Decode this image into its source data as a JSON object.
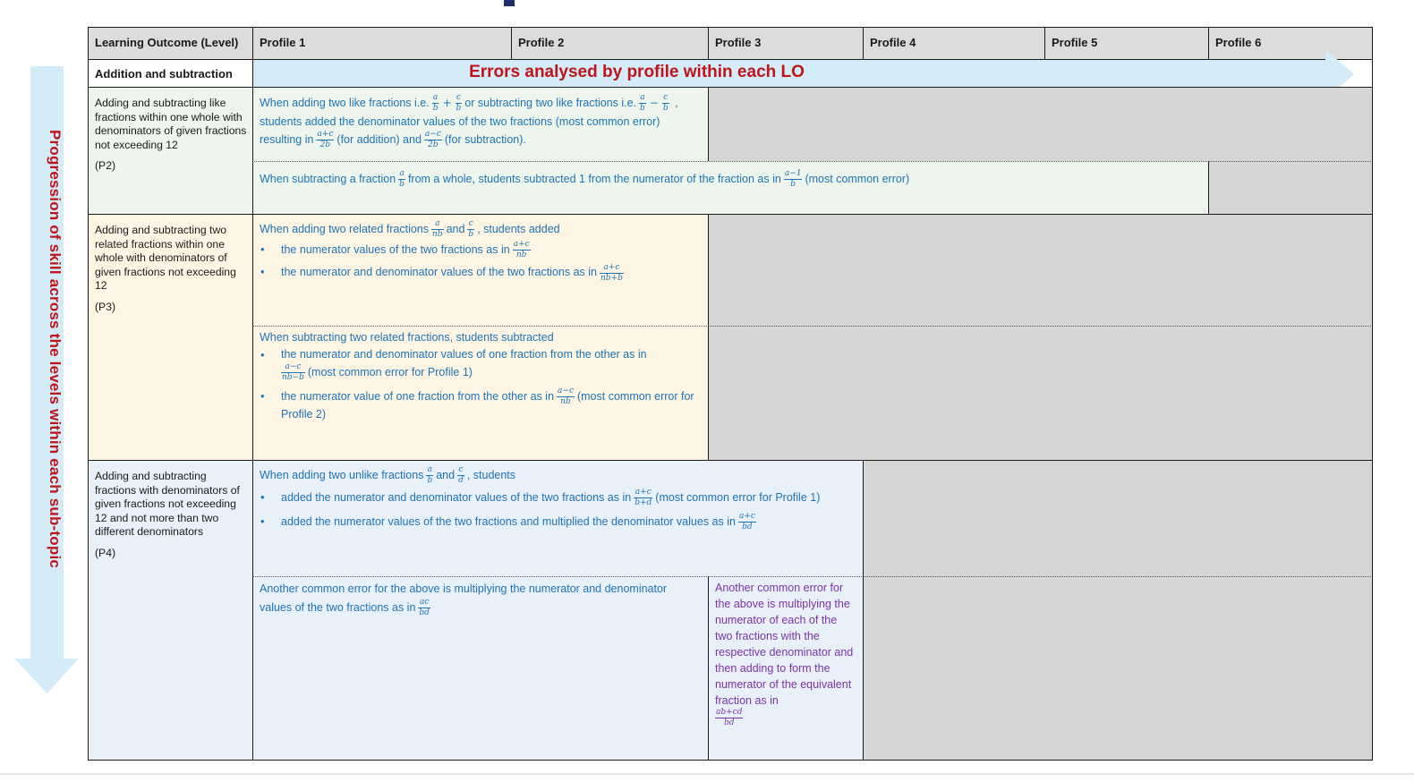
{
  "colors": {
    "header_bg": "#dcdcdc",
    "grey_cell": "#d6d6d6",
    "p2_bg": "#eef5ec",
    "p3_bg": "#fdf5e4",
    "p4_bg": "#e8f0f9",
    "arrow": "#d3ecf7",
    "red_text": "#c0141a",
    "blue_text": "#1f73b7",
    "purple_text": "#7c33a8"
  },
  "side_label": "Progression of skill across the levels within each sub-topic",
  "header": {
    "lo_col": "Learning Outcome (Level)",
    "profiles": [
      "Profile 1",
      "Profile 2",
      "Profile 3",
      "Profile 4",
      "Profile 5",
      "Profile 6"
    ]
  },
  "subtopic": {
    "name": "Addition and subtraction",
    "arrow_text": "Errors analysed by profile within each LO"
  },
  "rows": {
    "p2": {
      "lo_text": "Adding and subtracting like fractions within one whole with denominators of given fractions not exceeding 12",
      "level": "(P2)",
      "e1": {
        "t1": "When adding two like fractions i.e.",
        "t2": "or subtracting two like fractions i.e.",
        "t3": ", students added the denominator values of the two fractions (most common error) resulting in",
        "t4": "(for addition) and",
        "t5": "(for subtraction)."
      },
      "e2": {
        "t1": "When subtracting a fraction",
        "t2": "from a whole, students subtracted 1 from the numerator of the fraction as in",
        "t3": "(most common error)"
      }
    },
    "p3": {
      "lo_text": "Adding and subtracting two related fractions within one whole with denominators of given fractions not exceeding 12",
      "level": "(P3)",
      "e1": {
        "t1": "When adding two related fractions",
        "t2": "and",
        "t3": ", students added",
        "b1": "the numerator values of the two fractions as in",
        "b2": "the numerator and denominator values of the two fractions as in"
      },
      "e2": {
        "t1": "When subtracting two related fractions, students subtracted",
        "b1a": "the numerator and denominator values of one fraction from the other as in",
        "b1b": "(most common error for Profile 1)",
        "b2a": "the numerator value of one fraction from the other as in",
        "b2b": "(most common error for Profile 2)"
      }
    },
    "p4": {
      "lo_text": "Adding and subtracting fractions with denominators of given fractions not exceeding 12 and not more than two different denominators",
      "level": "(P4)",
      "e1": {
        "t1": "When adding two unlike fractions",
        "t2": "and",
        "t3": ", students",
        "b1a": "added the numerator and denominator values of the two fractions as in",
        "b1b": "(most common error for Profile 1)",
        "b2": "added the numerator values of the two fractions and multiplied the denominator values as in"
      },
      "e2": {
        "text": "Another common error for the above is multiplying the numerator and denominator values of the two fractions as in"
      },
      "e3": {
        "text": "Another common error for the above is multiplying the numerator of each of the two fractions with the respective denominator and then adding to form the numerator of the equivalent fraction as in"
      }
    }
  }
}
